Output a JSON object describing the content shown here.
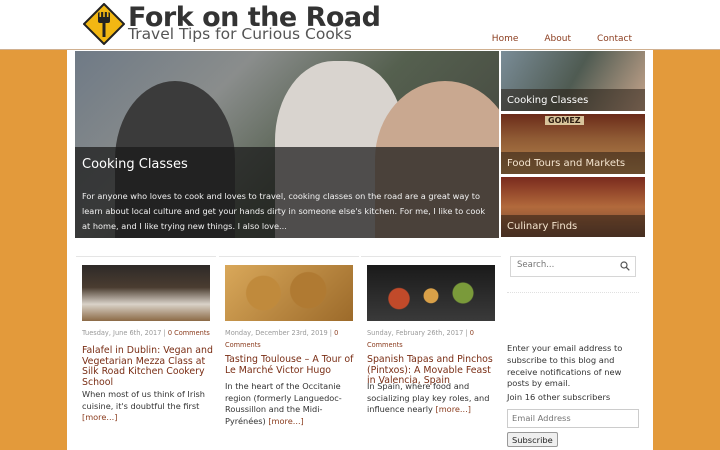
{
  "site": {
    "title": "Fork on the Road",
    "tagline": "Travel Tips for Curious Cooks"
  },
  "nav": {
    "items": [
      {
        "label": "Home"
      },
      {
        "label": "About"
      },
      {
        "label": "Contact"
      }
    ]
  },
  "hero": {
    "title": "Cooking Classes",
    "text": "For anyone who loves to cook and loves to travel, cooking classes on the road are a great way to learn about local culture and get your hands dirty in someone else's kitchen. For me, I like to cook at home, and I like trying new things. I also love..."
  },
  "categories": [
    {
      "label": "Cooking Classes"
    },
    {
      "label": "Food Tours and Markets",
      "sign": "GOMEZ"
    },
    {
      "label": "Culinary Finds"
    }
  ],
  "posts": [
    {
      "meta_date": "Tuesday, June 6th, 2017 | ",
      "meta_comments": "0 Comments",
      "title": "Falafel in Dublin: Vegan and Vegetarian Mezza Class at Silk Road Kitchen Cookery School",
      "excerpt": "When most of us think of Irish cuisine, it's doubtful the first ",
      "more": "[more...]"
    },
    {
      "meta_date": "Monday, December 23rd, 2019 | ",
      "meta_comments": "0 Comments",
      "title": "Tasting Toulouse – A Tour of Le Marché Victor Hugo",
      "excerpt": "In the heart of the Occitanie region (formerly Languedoc-Roussillon and the Midi-Pyrénées) ",
      "more": "[more...]"
    },
    {
      "meta_date": "Sunday, February 26th, 2017 | ",
      "meta_comments": "0 Comments",
      "title": "Spanish Tapas and Pinchos (Pintxos): A Movable Feast in Valencia, Spain",
      "excerpt": "In Spain, where food and socializing play key roles, and influence nearly ",
      "more": "[more...]"
    }
  ],
  "sidebar": {
    "search_placeholder": "Search...",
    "subscribe_text": "Enter your email address to subscribe to this blog and receive notifications of new posts by email.",
    "subscriber_count": "Join 16 other subscribers",
    "email_placeholder": "Email Address",
    "subscribe_button": "Subscribe"
  },
  "colors": {
    "background": "#e39a3b",
    "accent": "#8b3d1f",
    "logo_yellow": "#f2b713"
  }
}
